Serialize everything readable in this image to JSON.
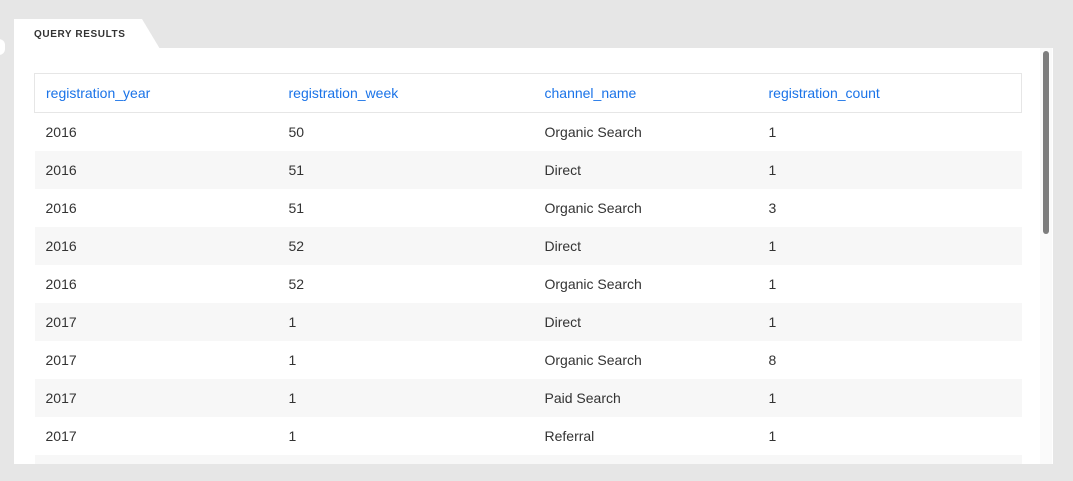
{
  "tab": {
    "label": "QUERY RESULTS"
  },
  "table": {
    "columns": [
      "registration_year",
      "registration_week",
      "channel_name",
      "registration_count"
    ],
    "rows": [
      [
        "2016",
        "50",
        "Organic Search",
        "1"
      ],
      [
        "2016",
        "51",
        "Direct",
        "1"
      ],
      [
        "2016",
        "51",
        "Organic Search",
        "3"
      ],
      [
        "2016",
        "52",
        "Direct",
        "1"
      ],
      [
        "2016",
        "52",
        "Organic Search",
        "1"
      ],
      [
        "2017",
        "1",
        "Direct",
        "1"
      ],
      [
        "2017",
        "1",
        "Organic Search",
        "8"
      ],
      [
        "2017",
        "1",
        "Paid Search",
        "1"
      ],
      [
        "2017",
        "1",
        "Referral",
        "1"
      ]
    ]
  },
  "colors": {
    "header_text": "#1a73e8",
    "body_text": "#333333",
    "row_alt": "#f7f7f7",
    "background": "#e6e6e6"
  }
}
